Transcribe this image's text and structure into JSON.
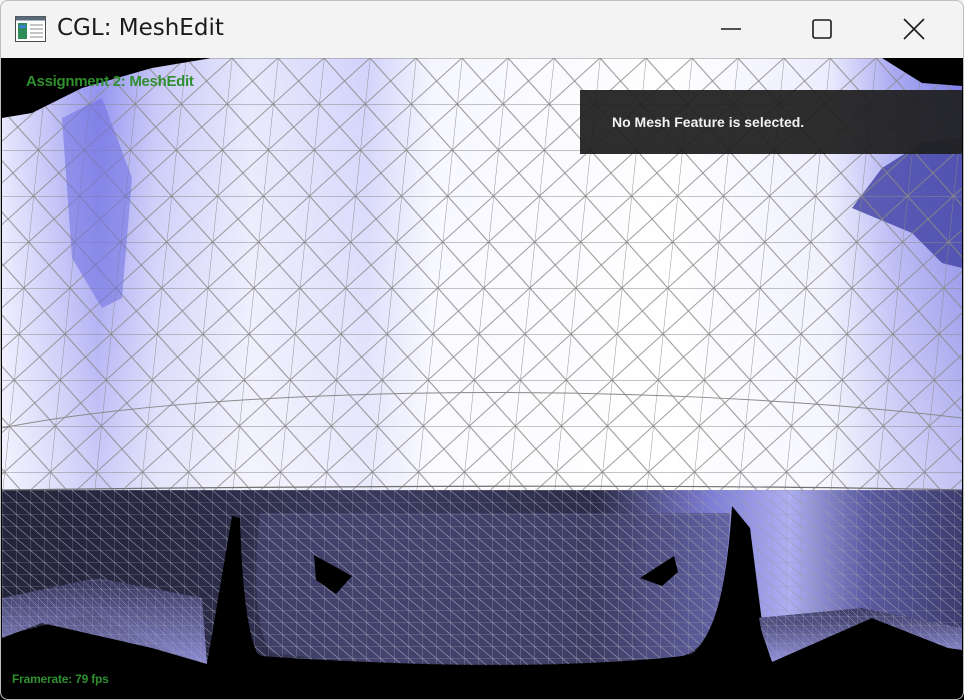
{
  "window": {
    "title": "CGL: MeshEdit",
    "app_icon": "app-window-icon",
    "controls": {
      "minimize_icon": "minimize-icon",
      "maximize_icon": "maximize-icon",
      "close_icon": "close-icon"
    }
  },
  "hud": {
    "title": "Assignment 2: MeshEdit",
    "selection_status": "No Mesh Feature is selected.",
    "framerate": "Framerate: 79 fps"
  },
  "colors": {
    "hud_text": "#2f8f2f",
    "mesh_light": "#f4f4ff",
    "mesh_shade": "#8c8cf0",
    "mesh_dark": "#27273f",
    "wire": "#8a8a8a",
    "background": "#000000"
  }
}
